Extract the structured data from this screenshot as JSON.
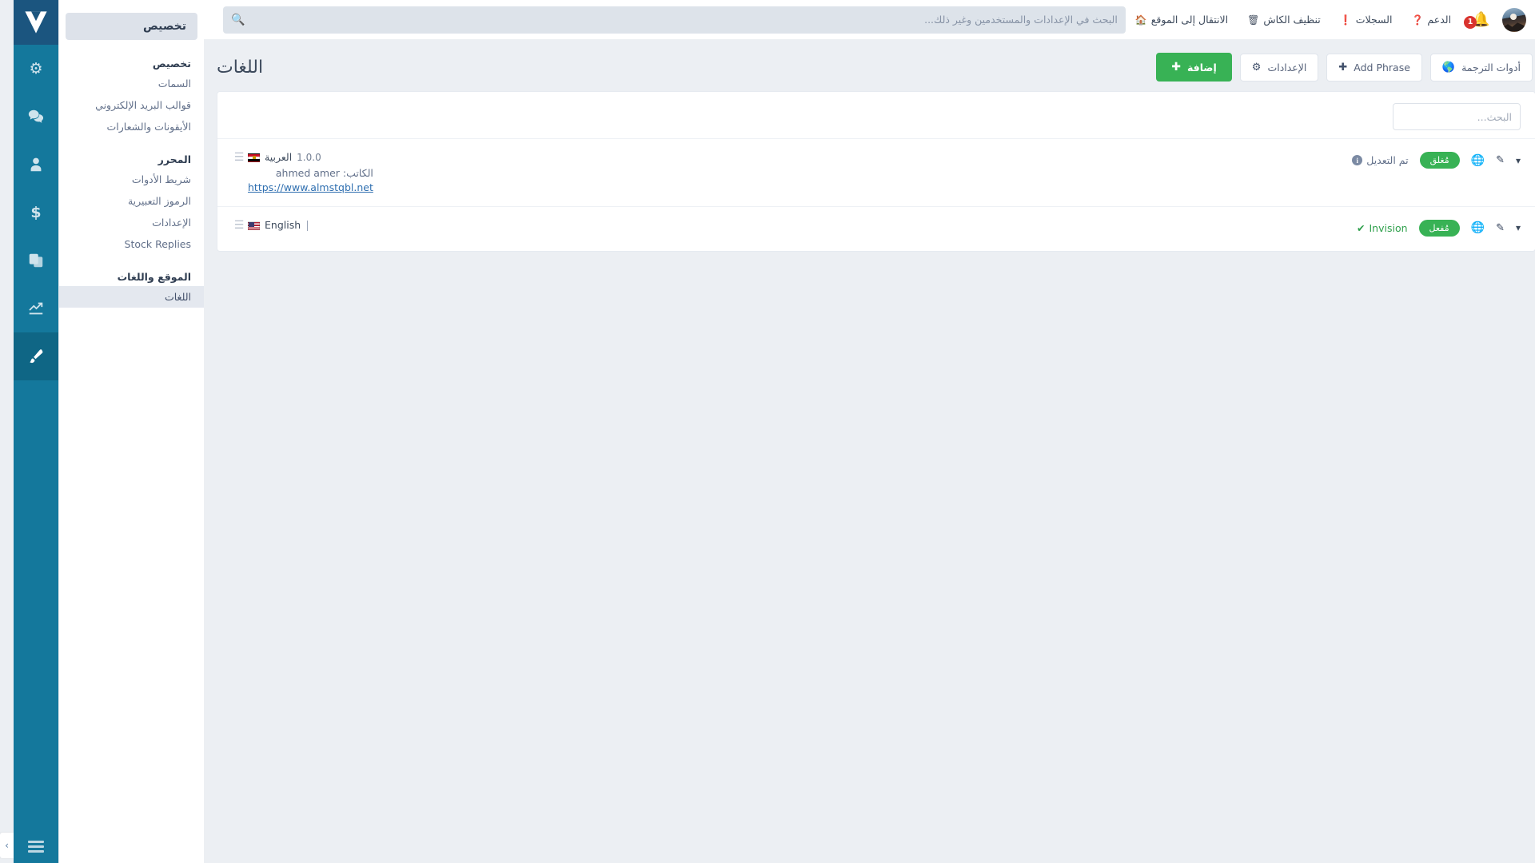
{
  "topbar": {
    "search": {
      "placeholder": "البحث في الإعدادات والمستخدمين وغير ذلك...",
      "value": "",
      "icon": "search-icon"
    },
    "links": [
      {
        "label": "الانتقال إلى الموقع",
        "icon": "home-icon"
      },
      {
        "label": "تنظيف الكاش",
        "icon": "trash-icon"
      },
      {
        "label": "السجلات",
        "icon": "exclamation-circle-icon"
      },
      {
        "label": "الدعم",
        "icon": "question-circle-icon"
      }
    ],
    "notifications": {
      "icon": "bell-icon",
      "count": "1"
    },
    "user": {
      "avatar": "avatar",
      "caret": "chevron-down-icon"
    }
  },
  "icon_rail": {
    "logo": "invision-logo-icon",
    "items": [
      {
        "name": "system-gears-icon",
        "active": false
      },
      {
        "name": "community-chat-icon",
        "active": false
      },
      {
        "name": "members-user-icon",
        "active": false
      },
      {
        "name": "commerce-dollar-icon",
        "active": false
      },
      {
        "name": "pages-copy-icon",
        "active": false
      },
      {
        "name": "stats-chart-icon",
        "active": false
      },
      {
        "name": "customization-brush-icon",
        "active": true
      }
    ],
    "bottom": {
      "name": "menu-bars-icon"
    },
    "collapse": {
      "name": "chevron-right-icon",
      "label": "›"
    }
  },
  "settings_nav": {
    "title": "تخصيص",
    "groups": [
      {
        "title": "تخصيص",
        "items": [
          {
            "label": "السمات",
            "active": false
          },
          {
            "label": "قوالب البريد الإلكتروني",
            "active": false
          },
          {
            "label": "الأيقونات والشعارات",
            "active": false
          }
        ]
      },
      {
        "title": "المحرر",
        "items": [
          {
            "label": "شريط الأدوات",
            "active": false
          },
          {
            "label": "الرموز التعبيرية",
            "active": false
          },
          {
            "label": "الإعدادات",
            "active": false
          },
          {
            "label": "Stock Replies",
            "active": false
          }
        ]
      },
      {
        "title": "الموقع واللغات",
        "items": [
          {
            "label": "اللغات",
            "active": true
          }
        ]
      }
    ]
  },
  "page": {
    "title": "اللغات",
    "toolbar": [
      {
        "label": "إضافة",
        "icon": "plus-icon",
        "style": "primary"
      },
      {
        "label": "الإعدادات",
        "icon": "gears-icon",
        "style": "default"
      },
      {
        "label": "Add Phrase",
        "icon": "plus-icon",
        "style": "default"
      },
      {
        "label": "أدوات الترجمة",
        "icon": "globe-icon",
        "style": "default"
      }
    ],
    "filter": {
      "placeholder": "البحث...",
      "value": ""
    },
    "languages": [
      {
        "drag": "drag-handle-icon",
        "flag": "eg",
        "name": "العربية",
        "version": "1.0.0",
        "author_label": "الكاتب:",
        "author_value": "ahmed amer",
        "url": "https://www.almstqbl.net",
        "badge": "مُغلق",
        "status_text": "تم التعديل",
        "status_icon": "info-circle-icon",
        "status_kind": "info",
        "has_separator": false,
        "actions": [
          "globe-icon",
          "pencil-icon",
          "chevron-down-icon"
        ]
      },
      {
        "drag": "drag-handle-icon",
        "flag": "us",
        "name": "English",
        "version": "",
        "author_label": "",
        "author_value": "",
        "url": "",
        "badge": "مُفعل",
        "status_text": "Invision",
        "status_icon": "check-icon",
        "status_kind": "ok",
        "has_separator": true,
        "actions": [
          "globe-icon",
          "pencil-icon",
          "chevron-down-icon"
        ]
      }
    ]
  },
  "colors": {
    "rail": "#14789c",
    "rail_logo": "#1b557f",
    "rail_active": "#0f6685",
    "primary_green": "#38b255",
    "badge_red": "#d9332e",
    "link_blue": "#2f6fb0",
    "page_bg": "#eceff3"
  }
}
